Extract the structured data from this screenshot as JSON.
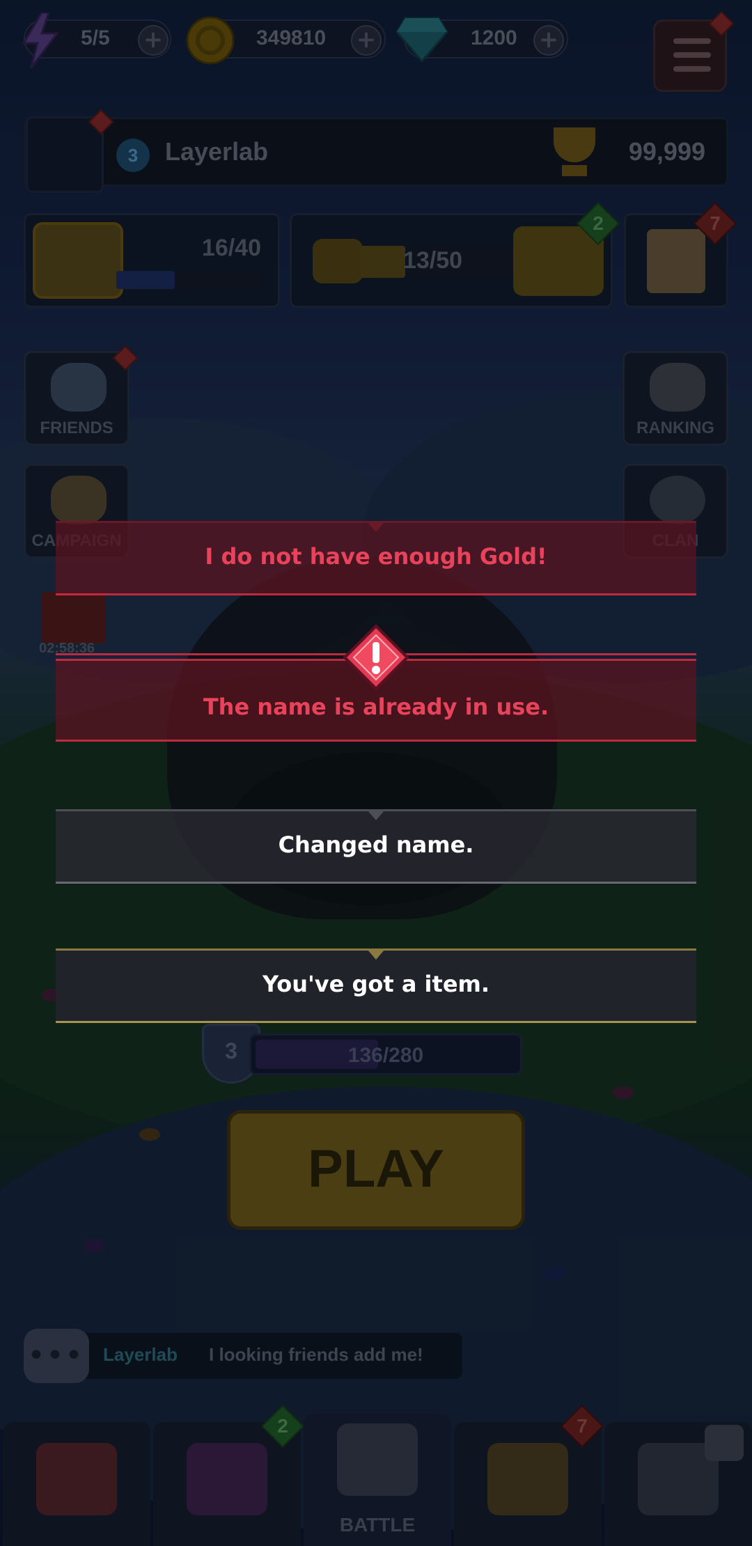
{
  "resources": {
    "energy": "5/5",
    "gold": "349810",
    "gems": "1200",
    "plus": "+"
  },
  "profile": {
    "level": "3",
    "name": "Layerlab",
    "trophies": "99,999"
  },
  "panels": {
    "chest_progress": "16/40",
    "chest_fraction": 0.4,
    "crown_progress": "13/50",
    "crown_fraction": 0.26,
    "castle_badge": "2",
    "quest_badge": "7"
  },
  "side_buttons": {
    "friends": "FRIENDS",
    "ranking": "RANKING",
    "campaign": "CAMPAIGN",
    "clan": "CLAN",
    "gift_timer": "02:58:36"
  },
  "hero": {
    "level": "3",
    "xp": "136/280",
    "xp_fraction": 0.486
  },
  "play_button": "PLAY",
  "chat": {
    "sender": "Layerlab",
    "message": "I looking friends add me!"
  },
  "nav": {
    "battle_label": "BATTLE",
    "book_badge": "2",
    "chest_badge": "7"
  },
  "toasts": [
    {
      "text": "I do not have enough Gold!",
      "style": "error",
      "color": "#e8435a"
    },
    {
      "text": "The name is already in use.",
      "style": "error-icon",
      "color": "#e8435a"
    },
    {
      "text": "Changed name.",
      "style": "neutral",
      "color": "#ffffff"
    },
    {
      "text": "You've got a item.",
      "style": "reward",
      "color": "#ffffff"
    }
  ],
  "icons": {
    "energy": "lightning-icon",
    "gold": "coin-icon",
    "gems": "diamond-icon",
    "menu": "hamburger-icon",
    "alert": "exclamation-icon",
    "trophy": "trophy-icon",
    "lock": "lock-icon"
  }
}
